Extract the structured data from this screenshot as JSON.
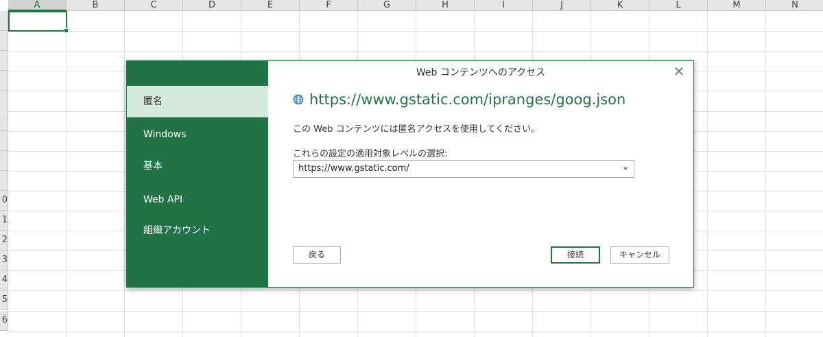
{
  "spreadsheet": {
    "columns": [
      "A",
      "B",
      "C",
      "D",
      "E",
      "F",
      "G",
      "H",
      "I",
      "J",
      "K",
      "L",
      "M",
      "N"
    ],
    "active_column": "A",
    "rows": [
      "",
      "",
      "",
      "",
      "",
      "",
      "",
      "",
      "",
      "0",
      "1",
      "2",
      "3",
      "4",
      "5",
      "6"
    ]
  },
  "dialog": {
    "title": "Web コンテンツへのアクセス",
    "sidebar": [
      {
        "label": "匿名",
        "selected": true
      },
      {
        "label": "Windows"
      },
      {
        "label": "基本"
      },
      {
        "label": "Web API"
      },
      {
        "label": "組織アカウント"
      }
    ],
    "url": "https://www.gstatic.com/ipranges/goog.json",
    "description": "この Web コンテンツには匿名アクセスを使用してください。",
    "level_label": "これらの設定の適用対象レベルの選択:",
    "level_value": "https://www.gstatic.com/",
    "back_label": "戻る",
    "connect_label": "接続",
    "cancel_label": "キャンセル"
  },
  "colors": {
    "accent": "#217346",
    "sidebar_selected": "#d4eadb"
  },
  "icons": {
    "url": "globe-icon",
    "close": "close-icon",
    "dropdown": "chevron-down-icon"
  }
}
